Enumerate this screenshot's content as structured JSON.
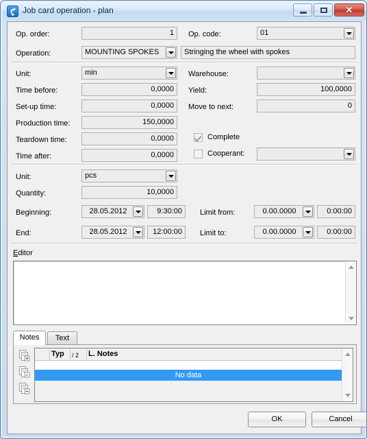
{
  "window": {
    "title": "Job card operation - plan",
    "icon": "app-swirl-icon",
    "controls": {
      "minimize": "–",
      "maximize": "□",
      "close": "✕"
    }
  },
  "section_header": {
    "op_order_label": "Op. order:",
    "op_order_value": "1",
    "op_code_label": "Op. code:",
    "op_code_value": "01",
    "operation_label": "Operation:",
    "operation_value": "MOUNTING SPOKES",
    "operation_description": "Stringing the wheel with spokes"
  },
  "section_times": {
    "unit_label": "Unit:",
    "unit_value": "min",
    "time_before_label": "Time before:",
    "time_before_value": "0,0000",
    "setup_time_label": "Set-up time:",
    "setup_time_value": "0,0000",
    "production_time_label": "Production time:",
    "production_time_value": "150,0000",
    "teardown_time_label": "Teardown time:",
    "teardown_time_value": "0,0000",
    "time_after_label": "Time after:",
    "time_after_value": "0,0000",
    "warehouse_label": "Warehouse:",
    "warehouse_value": "",
    "yield_label": "Yield:",
    "yield_value": "100,0000",
    "move_to_next_label": "Move to next:",
    "move_to_next_value": "0",
    "complete_label": "Complete",
    "complete_checked": true,
    "cooperant_label": "Cooperant:",
    "cooperant_checked": false,
    "cooperant_value": ""
  },
  "section_quantity": {
    "unit_label": "Unit:",
    "unit_value": "pcs",
    "quantity_label": "Quantity:",
    "quantity_value": "10,0000",
    "beginning_label": "Beginning:",
    "beginning_date": "28.05.2012",
    "beginning_time": "9:30:00",
    "end_label": "End:",
    "end_date": "28.05.2012",
    "end_time": "12:00:00",
    "limit_from_label": "Limit from:",
    "limit_from_date": "0.00.0000",
    "limit_from_time": "0:00:00",
    "limit_to_label": "Limit to:",
    "limit_to_date": "0.00.0000",
    "limit_to_time": "0:00:00"
  },
  "editor": {
    "label_accel": "E",
    "label_rest": "ditor",
    "content": ""
  },
  "notes": {
    "tabs": [
      {
        "label": "Notes",
        "active": true
      },
      {
        "label": "Text",
        "active": false
      }
    ],
    "toolbar_icons": [
      "add-note-icon",
      "edit-note-icon",
      "delete-note-icon"
    ],
    "columns": [
      "Typ",
      "/ 2",
      "L. Notes"
    ],
    "empty_text": "No data"
  },
  "footer": {
    "ok_label": "OK",
    "cancel_label": "Cancel"
  },
  "colors": {
    "selection": "#3399f3",
    "title_text": "#0c2a47",
    "close_button": "#bb3a2c"
  }
}
